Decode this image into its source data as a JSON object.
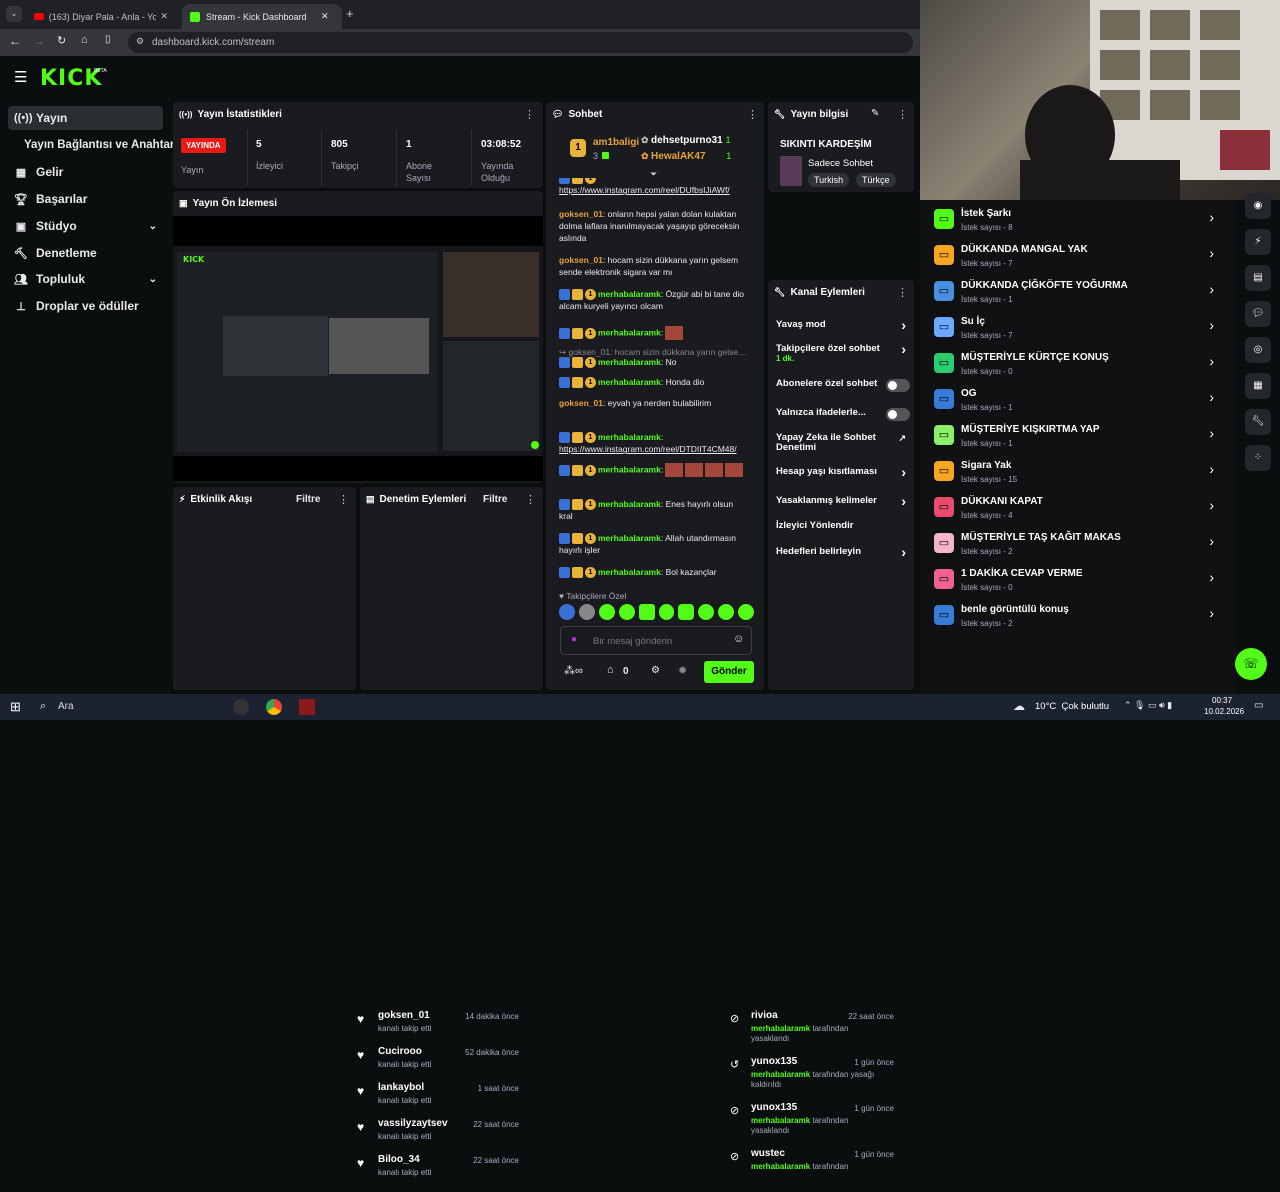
{
  "browser": {
    "tabs": [
      {
        "label": "(163) Diyar Pala - Anla - Yo"
      },
      {
        "label": "Stream - Kick Dashboard"
      }
    ],
    "url": "dashboard.kick.com/stream"
  },
  "brand": {
    "logo": "KICK",
    "beta": "BETA"
  },
  "sidebar": {
    "items": [
      {
        "label": "Yayın",
        "icon": "broadcast-icon"
      },
      {
        "label": "Yayın Bağlantısı ve Anahtarı"
      },
      {
        "label": "Gelir",
        "icon": "revenue-icon"
      },
      {
        "label": "Başarılar",
        "icon": "trophy-icon"
      },
      {
        "label": "Stüdyo",
        "icon": "studio-icon"
      },
      {
        "label": "Denetleme",
        "icon": "moderation-icon"
      },
      {
        "label": "Topluluk",
        "icon": "community-icon"
      },
      {
        "label": "Droplar ve ödüller",
        "icon": "drops-icon"
      }
    ]
  },
  "stats": {
    "title": "Yayın İstatistikleri",
    "live": "YAYINDA",
    "live_label": "Yayın",
    "items": [
      {
        "value": "5",
        "label": "İzleyici"
      },
      {
        "value": "805",
        "label": "Takipçi"
      },
      {
        "value": "1",
        "label": "Abone Sayısı"
      },
      {
        "value": "03:08:52",
        "label": "Yayında Olduğu"
      }
    ]
  },
  "preview": {
    "title": "Yayın Ön İzlemesi"
  },
  "activity": {
    "title": "Etkinlik Akışı",
    "filter": "Filtre",
    "events": [
      {
        "name": "goksen_01",
        "sub": "kanalı takip etti",
        "time": "14 dakika önce"
      },
      {
        "name": "Cucirooo",
        "sub": "kanalı takip etti",
        "time": "52 dakika önce"
      },
      {
        "name": "lankaybol",
        "sub": "kanalı takip etti",
        "time": "1 saat önce"
      },
      {
        "name": "vassilyzaytsev",
        "sub": "kanalı takip etti",
        "time": "22 saat önce"
      },
      {
        "name": "Biloo_34",
        "sub": "kanalı takip etti",
        "time": "22 saat önce"
      }
    ]
  },
  "modlog": {
    "title": "Denetim Eylemleri",
    "filter": "Filtre",
    "items": [
      {
        "name": "rivioa",
        "time": "22 saat önce",
        "actor": "merhabalaramk",
        "rest": " tarafından",
        "line2": "yasaklandı"
      },
      {
        "name": "yunox135",
        "time": "1 gün önce",
        "actor": "merhabalaramk",
        "rest": " tarafından yasağı",
        "line2": "kaldırıldı"
      },
      {
        "name": "yunox135",
        "time": "1 gün önce",
        "actor": "merhabalaramk",
        "rest": " tarafından",
        "line2": "yasaklandı"
      },
      {
        "name": "wustec",
        "time": "1 gün önce",
        "actor": "merhabalaramk",
        "rest": " tarafından",
        "line2": ""
      }
    ]
  },
  "chat": {
    "title": "Sohbet",
    "top_gifters": [
      {
        "name": "am1baligi",
        "count": "3",
        "rank": "1"
      },
      {
        "name": "dehsetpurno31",
        "count": "1"
      },
      {
        "name": "HewalAK47",
        "count": "1"
      }
    ],
    "partial_top": "https://www.instagram.com/reel/DUfbsIJiAWf/",
    "messages": [
      {
        "user": "goksen_01",
        "text": ": onların hepsi yalan dolan kulaktan dolma laflara inanılmayacak yaşayıp göreceksin aslında"
      },
      {
        "user": "goksen_01",
        "text": ": hocam sizin dükkana yarın gelsem sende elektronik sigara var mı"
      },
      {
        "user": "merhabalaramk",
        "text": ": Özgür abi bi tane dio alcam kuryeli yayıncı olcam"
      },
      {
        "user": "merhabalaramk",
        "text": ":"
      },
      {
        "reply": "goksen_01: hocam sizin dükkana yarın gelse..."
      },
      {
        "user": "merhabalaramk",
        "text": ": No"
      },
      {
        "user": "merhabalaramk",
        "text": ": Honda dio"
      },
      {
        "user": "goksen_01",
        "text": ": eyvah ya nerden bulabilirim"
      },
      {
        "user": "merhabalaramk",
        "text": ":",
        "link": "https://www.instagram.com/reel/DTDIIT4CM48/"
      },
      {
        "user": "merhabalaramk",
        "text": ":"
      },
      {
        "user": "merhabalaramk",
        "text": ": Enes hayırlı olsun kral"
      },
      {
        "user": "merhabalaramk",
        "text": ": Allah utandırmasın hayırlı işler"
      },
      {
        "user": "merhabalaramk",
        "text": ": Bol kazançlar"
      }
    ],
    "followers_only": "Takipçilere Özel",
    "input_placeholder": "Bir mesaj gönderin",
    "points": "0",
    "send": "Gönder"
  },
  "stream_info": {
    "title": "Yayın bilgisi",
    "stream_title": "SIKINTI KARDEŞİM",
    "category": "Sadece Sohbet",
    "tags": [
      "Turkish",
      "Türkçe"
    ]
  },
  "channel_actions": {
    "title": "Kanal Eylemleri",
    "items": [
      {
        "label": "Yavaş mod",
        "type": "chevron"
      },
      {
        "label": "Takipçilere özel sohbet",
        "sub": "1 dk.",
        "type": "chevron"
      },
      {
        "label": "Abonelere özel sohbet",
        "type": "toggle"
      },
      {
        "label": "Yalnızca ifadelerle...",
        "type": "toggle"
      },
      {
        "label": "Yapay Zeka ile Sohbet Denetimi",
        "type": "external"
      },
      {
        "label": "Hesap yaşı kısıtlaması",
        "type": "chevron"
      },
      {
        "label": "Yasaklanmış kelimeler",
        "type": "chevron"
      },
      {
        "label": "İzleyici Yönlendir",
        "type": "none"
      },
      {
        "label": "Hedefleri belirleyin",
        "type": "chevron"
      }
    ]
  },
  "commands": [
    {
      "title": "İstek Şarkı",
      "sub": "İstek sayısı - 8",
      "color": "#53fc18"
    },
    {
      "title": "DÜKKANDA MANGAL YAK",
      "sub": "İstek sayısı - 7",
      "color": "#f5a623"
    },
    {
      "title": "DÜKKANDA ÇİĞKÖFTE YOĞURMA",
      "sub": "İstek sayısı - 1",
      "color": "#4a90e2"
    },
    {
      "title": "Su İç",
      "sub": "İstek sayısı - 7",
      "color": "#6fa8ff"
    },
    {
      "title": "MÜŞTERİYLE KÜRTÇE KONUŞ",
      "sub": "İstek sayısı - 0",
      "color": "#2ecc71"
    },
    {
      "title": "OG",
      "sub": "İstek sayısı - 1",
      "color": "#3a7bd5"
    },
    {
      "title": "MÜŞTERİYE KIŞKIRTMA YAP",
      "sub": "İstek sayısı - 1",
      "color": "#8ef067"
    },
    {
      "title": "Sigara Yak",
      "sub": "İstek sayısı - 15",
      "color": "#f5a623"
    },
    {
      "title": "DÜKKANI KAPAT",
      "sub": "İstek sayısı - 4",
      "color": "#e74c6c"
    },
    {
      "title": "MÜŞTERİYLE TAŞ KAĞIT MAKAS",
      "sub": "İstek sayısı - 2",
      "color": "#f4b6c8"
    },
    {
      "title": "1 DAKİKA CEVAP VERME",
      "sub": "İstek sayısı - 0",
      "color": "#f06292"
    },
    {
      "title": "benle görüntülü konuş",
      "sub": "İstek sayısı - 2",
      "color": "#3a7bd5"
    }
  ],
  "taskbar": {
    "search": "Ara",
    "weather": "10°C  Çok bulutlu",
    "time": "00:37",
    "date": "10.02.2026"
  }
}
